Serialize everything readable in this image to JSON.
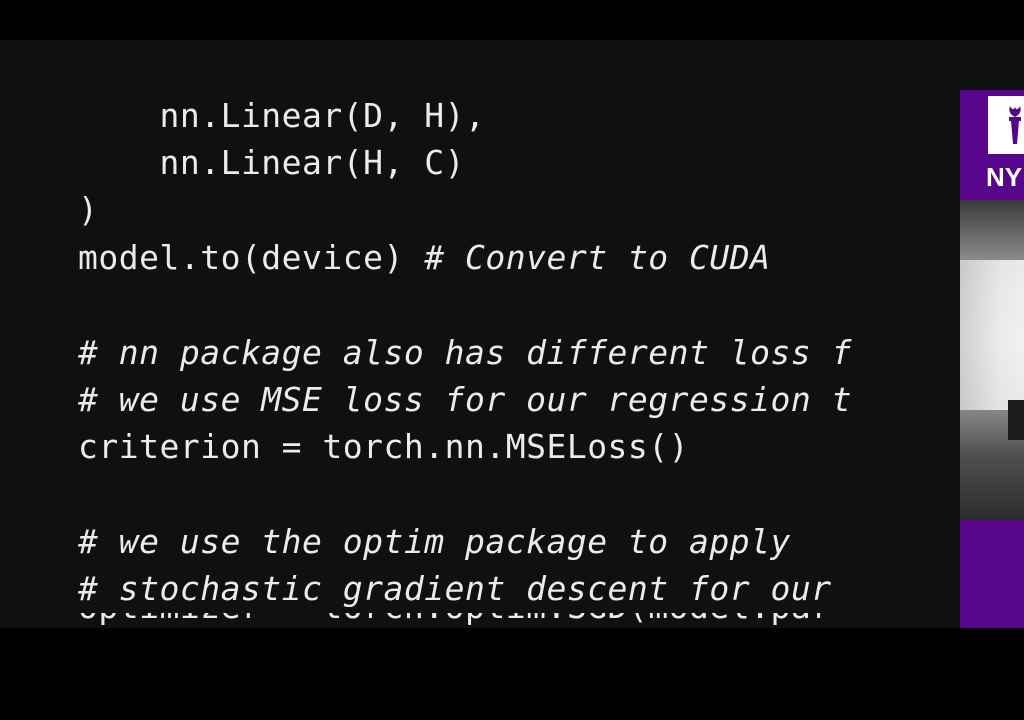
{
  "slide": {
    "code_lines": [
      {
        "text": "    nn.Linear(D, H),",
        "style": "code"
      },
      {
        "text": "    nn.Linear(H, C)",
        "style": "code"
      },
      {
        "text": ")",
        "style": "code"
      },
      {
        "text": "model.to(device) ",
        "style": "code",
        "comment": "# Convert to CUDA"
      },
      {
        "text": "",
        "style": "blank"
      },
      {
        "text": "# nn package also has different loss f",
        "style": "comment"
      },
      {
        "text": "# we use MSE loss for our regression t",
        "style": "comment"
      },
      {
        "text": "criterion = torch.nn.MSELoss()",
        "style": "code"
      },
      {
        "text": "",
        "style": "blank"
      },
      {
        "text": "# we use the optim package to apply",
        "style": "comment"
      },
      {
        "text": "# stochastic gradient descent for our",
        "style": "comment"
      },
      {
        "text": "optimizer = torch.optim.SGD(model.par",
        "style": "code-clipped"
      }
    ],
    "text_color": "#e9ebec",
    "background_color": "#0f1011"
  },
  "video_overlay": {
    "logo_text": "NY",
    "brand_color": "#57068c",
    "icon": "torch-icon"
  }
}
